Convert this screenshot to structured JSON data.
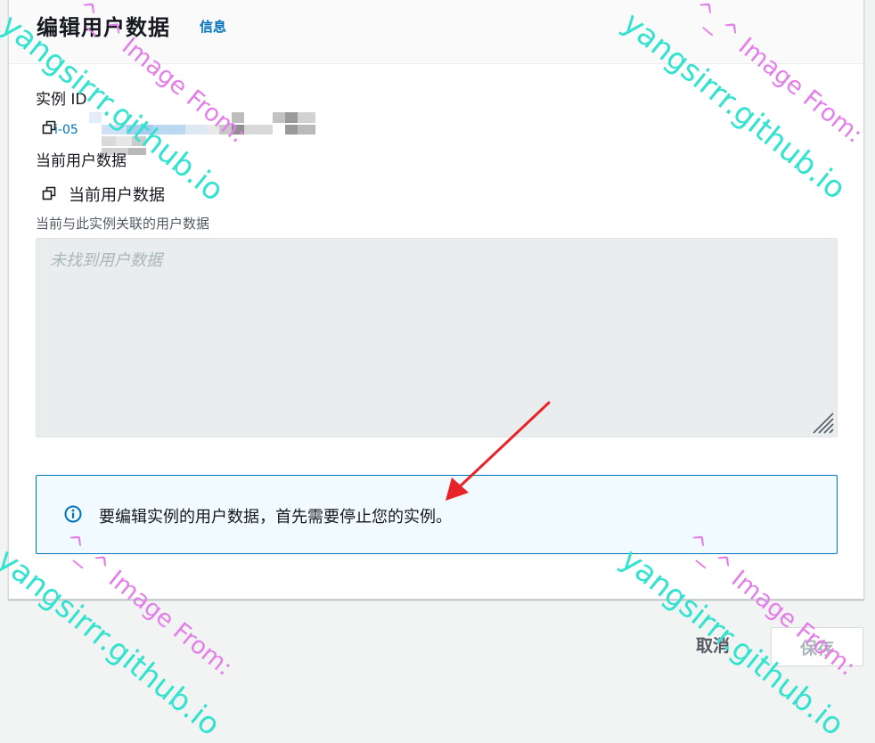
{
  "header": {
    "title": "编辑用户数据",
    "info_link": "信息"
  },
  "instance": {
    "label": "实例 ID",
    "id_visible_prefix": "i-05"
  },
  "user_data": {
    "section_label": "当前用户数据",
    "copy_label": "当前用户数据",
    "description": "当前与此实例关联的用户数据",
    "placeholder": "未找到用户数据"
  },
  "alert": {
    "text": "要编辑实例的用户数据，首先需要停止您的实例。"
  },
  "footer": {
    "cancel_label": "取消",
    "save_label": "保存"
  },
  "watermark": {
    "line_a": "^_^ Image From:",
    "line_b": "yangsirrr.github.io"
  },
  "colors": {
    "link": "#0073bb",
    "alert_border": "#0073bb",
    "alert_bg": "#f1faff",
    "annotation_arrow": "#e8232a",
    "textarea_bg": "#eaeded"
  },
  "icons": {
    "copy": "copy-icon",
    "info": "info-circle-icon",
    "resize": "resize-grip-icon"
  }
}
